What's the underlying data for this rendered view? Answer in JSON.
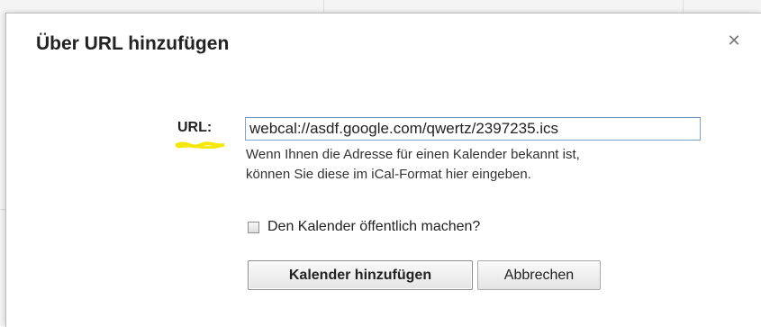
{
  "dialog": {
    "title": "Über URL hinzufügen",
    "close_glyph": "✕",
    "close_icon": "close-icon"
  },
  "form": {
    "url_label": "URL:",
    "url_value": "webcal://asdf.google.com/qwertz/2397235.ics",
    "hint_line1": "Wenn Ihnen die Adresse für einen Kalender bekannt ist,",
    "hint_line2": "können Sie diese im iCal-Format hier eingeben.",
    "public_checkbox_label": "Den Kalender öffentlich machen?",
    "public_checkbox_checked": false
  },
  "buttons": {
    "add_label": "Kalender hinzufügen",
    "cancel_label": "Abbrechen"
  },
  "colors": {
    "highlight": "#f5e800",
    "input_border": "#7da2ce"
  }
}
